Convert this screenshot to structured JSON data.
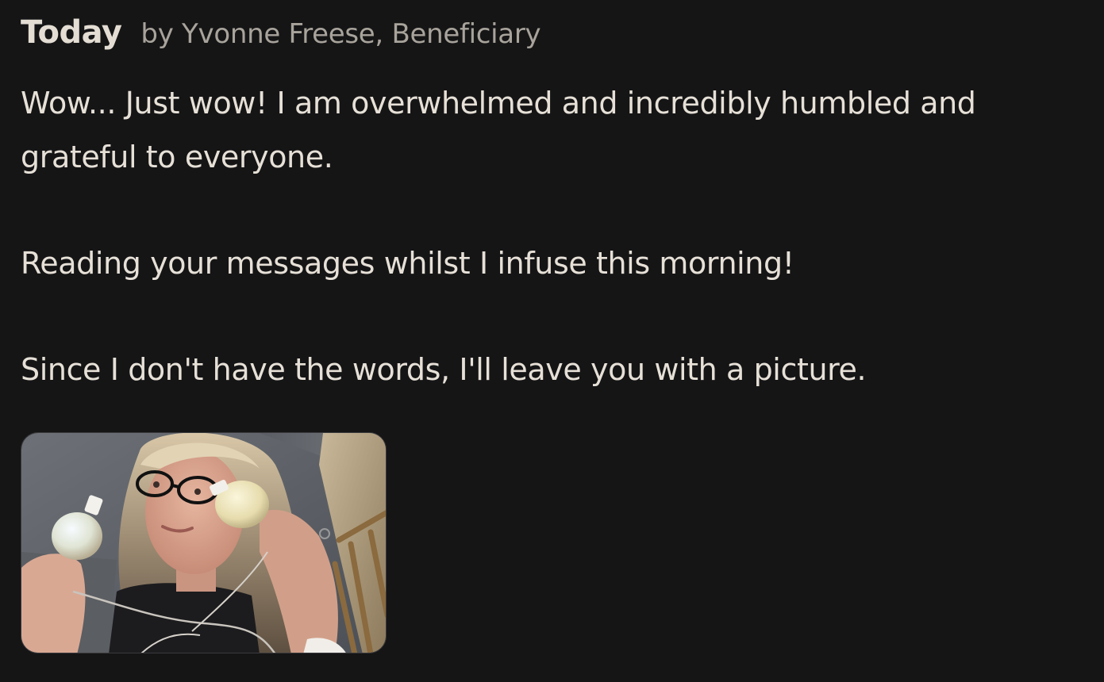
{
  "update": {
    "title": "Today",
    "byline": "by Yvonne Freese, Beneficiary",
    "paragraphs": [
      "Wow... Just wow! I am overwhelmed and incredibly humbled and grateful to everyone.",
      "Reading your messages whilst I infuse this morning!",
      "Since I don't have the words, I'll leave you with a picture."
    ]
  },
  "colors": {
    "background": "#151516",
    "title": "#e3ddd3",
    "byline": "#a8a39b",
    "body_text": "#e6e0d7"
  }
}
